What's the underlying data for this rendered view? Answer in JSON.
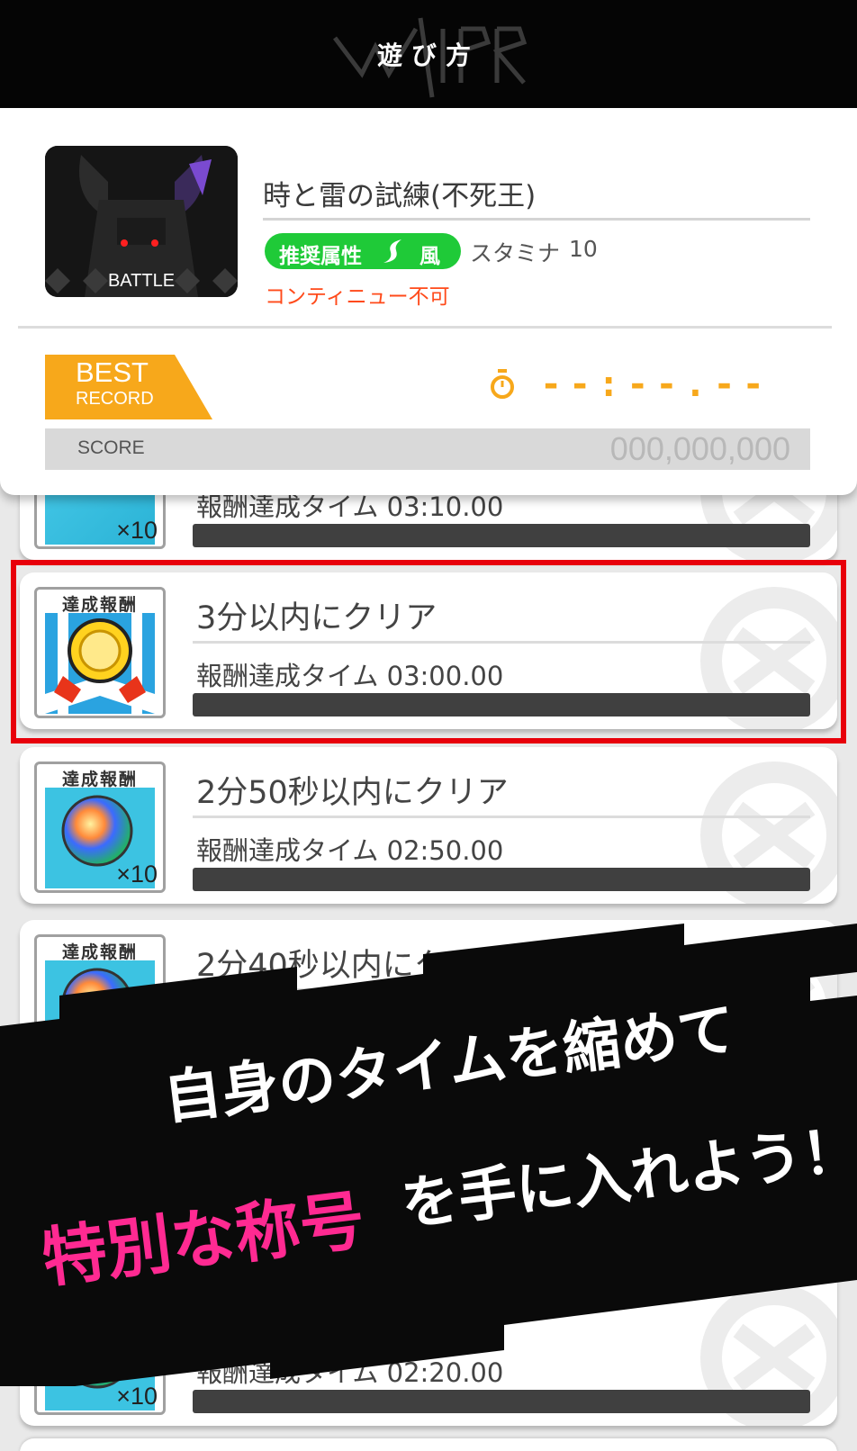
{
  "header": {
    "title": "遊び方",
    "logo_icon": "world-flipper-logo-icon"
  },
  "quest": {
    "title": "時と雷の試練(不死王)",
    "icon_label": "BATTLE",
    "recommended_label": "推奨属性",
    "element": "風",
    "stamina_label": "スタミナ",
    "stamina_value": "10",
    "continue_note": "コンティニュー不可"
  },
  "best_record": {
    "best_label": "BEST",
    "record_label": "RECORD",
    "time": "--:--.--",
    "score_label": "SCORE",
    "score_value": "000,000,000"
  },
  "rewards": [
    {
      "title": "",
      "time_label": "報酬達成タイム 03:10.00",
      "reward_label": "",
      "count": "×10",
      "type": "orb"
    },
    {
      "title": "3分以内にクリア",
      "time_label": "報酬達成タイム 03:00.00",
      "reward_label": "達成報酬",
      "count": "",
      "type": "medal",
      "highlighted": true
    },
    {
      "title": "2分50秒以内にクリア",
      "time_label": "報酬達成タイム 02:50.00",
      "reward_label": "達成報酬",
      "count": "×10",
      "type": "orb"
    },
    {
      "title": "2分40秒以内にクリア",
      "time_label": "",
      "reward_label": "達成報酬",
      "count": "",
      "type": "orb"
    },
    {
      "title": "",
      "time_label": "報酬達成タイム 02:20.00",
      "reward_label": "",
      "count": "×10",
      "type": "orb"
    }
  ],
  "promo": {
    "line1": "自身のタイムを縮めて",
    "line2_highlight": "特別な称号",
    "line2_rest": "を手に入れよう！"
  },
  "colors": {
    "accent_orange": "#f7a81b",
    "element_green": "#1fca38",
    "warning_red": "#ff4a1a",
    "highlight_red": "#e8000b",
    "promo_pink": "#ff2a92"
  }
}
